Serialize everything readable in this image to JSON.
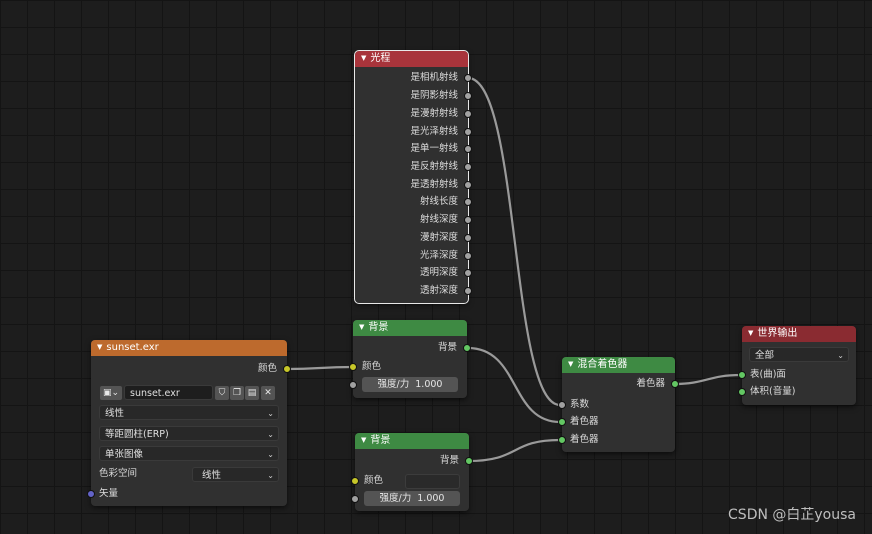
{
  "light_path": {
    "title": "光程",
    "outputs": [
      "是相机射线",
      "是阴影射线",
      "是漫射射线",
      "是光泽射线",
      "是单一射线",
      "是反射射线",
      "是透射射线",
      "射线长度",
      "射线深度",
      "漫射深度",
      "光泽深度",
      "透明深度",
      "透射深度"
    ]
  },
  "background1": {
    "title": "背景",
    "output": "背景",
    "color_label": "颜色",
    "strength_label": "强度/力",
    "strength_value": "1.000"
  },
  "background2": {
    "title": "背景",
    "output": "背景",
    "color_label": "颜色",
    "strength_label": "强度/力",
    "strength_value": "1.000"
  },
  "env_texture": {
    "title": "sunset.exr",
    "output": "颜色",
    "image_name": "sunset.exr",
    "interpolation": "线性",
    "projection": "等距圆柱(ERP)",
    "source": "单张图像",
    "colorspace_label": "色彩空间",
    "colorspace_value": "线性",
    "vector_label": "矢量"
  },
  "mix_shader": {
    "title": "混合着色器",
    "output": "着色器",
    "inputs": [
      "系数",
      "着色器",
      "着色器"
    ]
  },
  "world_output": {
    "title": "世界输出",
    "target": "全部",
    "inputs": [
      "表(曲)面",
      "体积(音量)"
    ]
  },
  "watermark": "CSDN @白芷yousa",
  "colors": {
    "header_input": "#a8343b",
    "header_shader": "#3e8a43",
    "header_texture": "#bd6a2d",
    "header_output": "#8a2b31",
    "socket_color": "#c7c729",
    "socket_shader": "#63c763",
    "socket_float": "#a1a1a1",
    "socket_vector": "#6363c7"
  }
}
